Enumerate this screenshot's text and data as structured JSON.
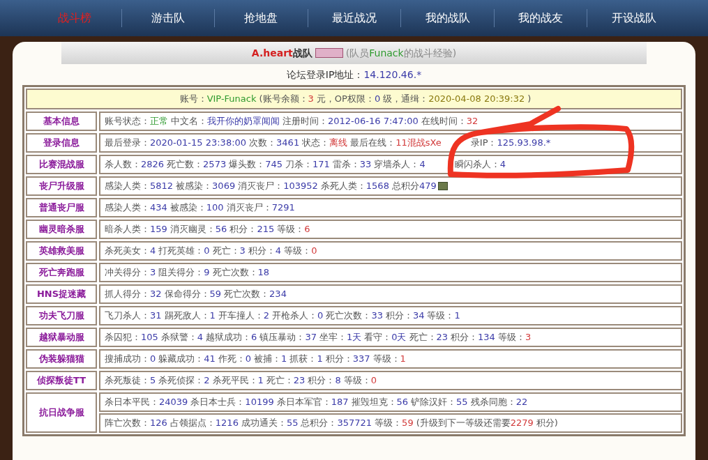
{
  "nav": [
    {
      "label": "战斗榜",
      "selected": true
    },
    {
      "label": "游击队",
      "selected": false
    },
    {
      "label": "抢地盘",
      "selected": false
    },
    {
      "label": "最近战况",
      "selected": false
    },
    {
      "label": "我的战队",
      "selected": false
    },
    {
      "label": "我的战友",
      "selected": false
    },
    {
      "label": "开设战队",
      "selected": false
    }
  ],
  "header": {
    "team": "A.heart",
    "team_suffix": "战队",
    "note_prefix": "(队员",
    "member": "Funack",
    "note_suffix": "的战斗经验)"
  },
  "ip_line": {
    "label": "论坛登录IP地址：",
    "value": "14.120.46.*"
  },
  "account": [
    {
      "text": "账号：",
      "kind": "plain"
    },
    {
      "text": "VIP-Funack",
      "kind": "ok"
    },
    {
      "text": "(账号余额：",
      "kind": "plain"
    },
    {
      "text": "3",
      "kind": "warn"
    },
    {
      "text": "元，OP权限：",
      "kind": "plain"
    },
    {
      "text": "0",
      "kind": "num"
    },
    {
      "text": "级，通缉：",
      "kind": "plain"
    },
    {
      "text": "2020-04-08 20:39:32",
      "kind": "date"
    },
    {
      "text": ")",
      "kind": "plain"
    }
  ],
  "rows": [
    {
      "label": "基本信息",
      "lines": [
        [
          {
            "text": "账号状态：",
            "kind": "plain"
          },
          {
            "text": "正常",
            "kind": "ok"
          },
          {
            "text": "中文名：",
            "kind": "plain"
          },
          {
            "text": "我开你的奶罩闻闻",
            "kind": "num"
          },
          {
            "text": "注册时间：",
            "kind": "plain"
          },
          {
            "text": "2012-06-16 7:47:00",
            "kind": "num"
          },
          {
            "text": "在线时间：",
            "kind": "plain"
          },
          {
            "text": "32",
            "kind": "warn"
          }
        ]
      ]
    },
    {
      "label": "登录信息",
      "lines": [
        [
          {
            "text": "最后登录：",
            "kind": "plain"
          },
          {
            "text": "2020-01-15 23:38:00",
            "kind": "num"
          },
          {
            "text": "次数：",
            "kind": "plain"
          },
          {
            "text": "3461",
            "kind": "num"
          },
          {
            "text": "状态：",
            "kind": "plain"
          },
          {
            "text": "离线",
            "kind": "warn"
          },
          {
            "text": "最后在线：",
            "kind": "plain"
          },
          {
            "text": "11混战sXe",
            "kind": "warn"
          },
          {
            "text": "录IP：",
            "kind": "plain",
            "gap_before": true
          },
          {
            "text": "125.93.98.*",
            "kind": "num"
          }
        ]
      ]
    },
    {
      "label": "比赛混战服",
      "lines": [
        [
          {
            "text": "杀人数：",
            "kind": "plain"
          },
          {
            "text": "2826",
            "kind": "num"
          },
          {
            "text": "死亡数：",
            "kind": "plain"
          },
          {
            "text": "2573",
            "kind": "num"
          },
          {
            "text": "爆头数：",
            "kind": "plain"
          },
          {
            "text": "745",
            "kind": "num"
          },
          {
            "text": "刀杀：",
            "kind": "plain"
          },
          {
            "text": "171",
            "kind": "num"
          },
          {
            "text": "雷杀：",
            "kind": "plain"
          },
          {
            "text": "33",
            "kind": "num"
          },
          {
            "text": "穿墙杀人：",
            "kind": "plain"
          },
          {
            "text": "4",
            "kind": "num"
          },
          {
            "text": "瞬闪杀人：",
            "kind": "plain",
            "gap_before": true
          },
          {
            "text": "4",
            "kind": "num"
          }
        ]
      ]
    },
    {
      "label": "丧尸升级服",
      "lines": [
        [
          {
            "text": "感染人类：",
            "kind": "plain"
          },
          {
            "text": "5812",
            "kind": "num"
          },
          {
            "text": "被感染：",
            "kind": "plain"
          },
          {
            "text": "3069",
            "kind": "num"
          },
          {
            "text": "消灭丧尸：",
            "kind": "plain"
          },
          {
            "text": "103952",
            "kind": "num"
          },
          {
            "text": "杀死人类：",
            "kind": "plain"
          },
          {
            "text": "1568",
            "kind": "num"
          },
          {
            "text": "总积分",
            "kind": "plain"
          },
          {
            "text": "479",
            "kind": "num"
          },
          {
            "kind": "icon"
          }
        ]
      ]
    },
    {
      "label": "普通丧尸服",
      "lines": [
        [
          {
            "text": "感染人类：",
            "kind": "plain"
          },
          {
            "text": "434",
            "kind": "num"
          },
          {
            "text": "被感染：",
            "kind": "plain"
          },
          {
            "text": "100",
            "kind": "num"
          },
          {
            "text": "消灭丧尸：",
            "kind": "plain"
          },
          {
            "text": "7291",
            "kind": "num"
          }
        ]
      ]
    },
    {
      "label": "幽灵暗杀服",
      "lines": [
        [
          {
            "text": "暗杀人类：",
            "kind": "plain"
          },
          {
            "text": "159",
            "kind": "num"
          },
          {
            "text": "消灭幽灵：",
            "kind": "plain"
          },
          {
            "text": "56",
            "kind": "num"
          },
          {
            "text": "积分：",
            "kind": "plain"
          },
          {
            "text": "215",
            "kind": "num"
          },
          {
            "text": "等级：",
            "kind": "plain"
          },
          {
            "text": "6",
            "kind": "warn"
          }
        ]
      ]
    },
    {
      "label": "英雄救美服",
      "lines": [
        [
          {
            "text": "杀死美女：",
            "kind": "plain"
          },
          {
            "text": "4",
            "kind": "num"
          },
          {
            "text": "打死英雄：",
            "kind": "plain"
          },
          {
            "text": "0",
            "kind": "num"
          },
          {
            "text": "死亡：",
            "kind": "plain"
          },
          {
            "text": "3",
            "kind": "num"
          },
          {
            "text": "积分：",
            "kind": "plain"
          },
          {
            "text": "4",
            "kind": "num"
          },
          {
            "text": "等级：",
            "kind": "plain"
          },
          {
            "text": "0",
            "kind": "warn"
          }
        ]
      ]
    },
    {
      "label": "死亡奔跑服",
      "lines": [
        [
          {
            "text": "冲关得分：",
            "kind": "plain"
          },
          {
            "text": "3",
            "kind": "num"
          },
          {
            "text": "阻关得分：",
            "kind": "plain"
          },
          {
            "text": "9",
            "kind": "num"
          },
          {
            "text": "死亡次数：",
            "kind": "plain"
          },
          {
            "text": "18",
            "kind": "num"
          }
        ]
      ]
    },
    {
      "label": "HNS捉迷藏",
      "lines": [
        [
          {
            "text": "抓人得分：",
            "kind": "plain"
          },
          {
            "text": "32",
            "kind": "num"
          },
          {
            "text": "保命得分：",
            "kind": "plain"
          },
          {
            "text": "59",
            "kind": "num"
          },
          {
            "text": "死亡次数：",
            "kind": "plain"
          },
          {
            "text": "234",
            "kind": "num"
          }
        ]
      ]
    },
    {
      "label": "功夫飞刀服",
      "lines": [
        [
          {
            "text": "飞刀杀人：",
            "kind": "plain"
          },
          {
            "text": "31",
            "kind": "num"
          },
          {
            "text": "踢死敌人：",
            "kind": "plain"
          },
          {
            "text": "1",
            "kind": "num"
          },
          {
            "text": "开车撞人：",
            "kind": "plain"
          },
          {
            "text": "2",
            "kind": "num"
          },
          {
            "text": "开枪杀人：",
            "kind": "plain"
          },
          {
            "text": "0",
            "kind": "num"
          },
          {
            "text": "死亡次数：",
            "kind": "plain"
          },
          {
            "text": "33",
            "kind": "num"
          },
          {
            "text": "积分：",
            "kind": "plain"
          },
          {
            "text": "34",
            "kind": "num"
          },
          {
            "text": "等级：",
            "kind": "plain"
          },
          {
            "text": "1",
            "kind": "num"
          }
        ]
      ]
    },
    {
      "label": "越狱暴动服",
      "lines": [
        [
          {
            "text": "杀囚犯：",
            "kind": "plain"
          },
          {
            "text": "105",
            "kind": "num"
          },
          {
            "text": "杀狱警：",
            "kind": "plain"
          },
          {
            "text": "4",
            "kind": "num"
          },
          {
            "text": "越狱成功：",
            "kind": "plain"
          },
          {
            "text": "6",
            "kind": "num"
          },
          {
            "text": "镇压暴动：",
            "kind": "plain"
          },
          {
            "text": "37",
            "kind": "num"
          },
          {
            "text": "坐牢：",
            "kind": "plain"
          },
          {
            "text": "1天",
            "kind": "num"
          },
          {
            "text": "看守：",
            "kind": "plain"
          },
          {
            "text": "0天",
            "kind": "num"
          },
          {
            "text": "死亡：",
            "kind": "plain"
          },
          {
            "text": "23",
            "kind": "num"
          },
          {
            "text": "积分：",
            "kind": "plain"
          },
          {
            "text": "134",
            "kind": "num"
          },
          {
            "text": "等级：",
            "kind": "plain"
          },
          {
            "text": "3",
            "kind": "warn"
          }
        ]
      ]
    },
    {
      "label": "伪装躲猫猫",
      "lines": [
        [
          {
            "text": "搜捕成功：",
            "kind": "plain"
          },
          {
            "text": "0",
            "kind": "num"
          },
          {
            "text": "躲藏成功：",
            "kind": "plain"
          },
          {
            "text": "41",
            "kind": "num"
          },
          {
            "text": "作死：",
            "kind": "plain"
          },
          {
            "text": "0",
            "kind": "num"
          },
          {
            "text": "被捕：",
            "kind": "plain"
          },
          {
            "text": "1",
            "kind": "num"
          },
          {
            "text": "抓获：",
            "kind": "plain"
          },
          {
            "text": "1",
            "kind": "num"
          },
          {
            "text": "积分：",
            "kind": "plain"
          },
          {
            "text": "337",
            "kind": "num"
          },
          {
            "text": "等级：",
            "kind": "plain"
          },
          {
            "text": "1",
            "kind": "warn"
          }
        ]
      ]
    },
    {
      "label": "侦探叛徒TT",
      "lines": [
        [
          {
            "text": "杀死叛徒：",
            "kind": "plain"
          },
          {
            "text": "5",
            "kind": "num"
          },
          {
            "text": "杀死侦探：",
            "kind": "plain"
          },
          {
            "text": "2",
            "kind": "num"
          },
          {
            "text": "杀死平民：",
            "kind": "plain"
          },
          {
            "text": "1",
            "kind": "num"
          },
          {
            "text": "死亡：",
            "kind": "plain"
          },
          {
            "text": "23",
            "kind": "num"
          },
          {
            "text": "积分：",
            "kind": "plain"
          },
          {
            "text": "8",
            "kind": "num"
          },
          {
            "text": "等级：",
            "kind": "plain"
          },
          {
            "text": "0",
            "kind": "warn"
          }
        ]
      ]
    },
    {
      "label": "抗日战争服",
      "lines": [
        [
          {
            "text": "杀日本平民：",
            "kind": "plain"
          },
          {
            "text": "24039",
            "kind": "num"
          },
          {
            "text": "杀日本士兵：",
            "kind": "plain"
          },
          {
            "text": "10199",
            "kind": "num"
          },
          {
            "text": "杀日本军官：",
            "kind": "plain"
          },
          {
            "text": "187",
            "kind": "num"
          },
          {
            "text": "摧毁坦克：",
            "kind": "plain"
          },
          {
            "text": "56",
            "kind": "num"
          },
          {
            "text": "铲除汉奸：",
            "kind": "plain"
          },
          {
            "text": "55",
            "kind": "num"
          },
          {
            "text": "残杀同胞：",
            "kind": "plain"
          },
          {
            "text": "22",
            "kind": "num"
          }
        ],
        [
          {
            "text": "阵亡次数：",
            "kind": "plain"
          },
          {
            "text": "126",
            "kind": "num"
          },
          {
            "text": "占领据点：",
            "kind": "plain"
          },
          {
            "text": "1216",
            "kind": "num"
          },
          {
            "text": "成功通关：",
            "kind": "plain"
          },
          {
            "text": "55",
            "kind": "num"
          },
          {
            "text": "总积分：",
            "kind": "plain"
          },
          {
            "text": "357721",
            "kind": "num"
          },
          {
            "text": "等级：",
            "kind": "plain"
          },
          {
            "text": "59",
            "kind": "warn"
          },
          {
            "text": "(升级到下一等级还需要",
            "kind": "plain"
          },
          {
            "text": "2279",
            "kind": "warn"
          },
          {
            "text": "积分)",
            "kind": "plain"
          }
        ]
      ]
    }
  ]
}
